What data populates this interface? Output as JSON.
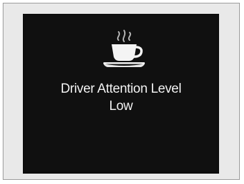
{
  "display": {
    "icon": "coffee-cup-icon",
    "title": "Driver Attention Level",
    "level": "Low",
    "colors": {
      "screen_background": "#101010",
      "text": "#f2f2f2",
      "frame_background": "#e9e9e9",
      "frame_border": "#9a9a9a"
    }
  }
}
